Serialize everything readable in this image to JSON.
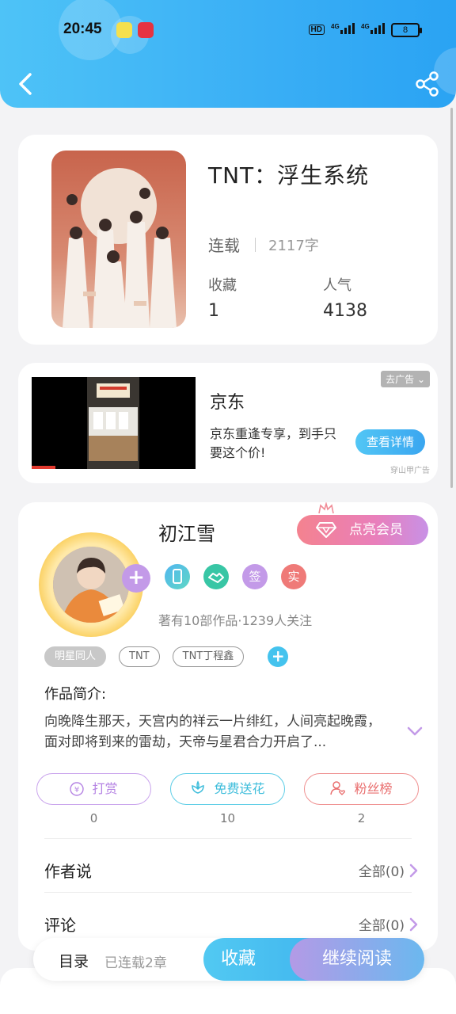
{
  "status_bar": {
    "time": "20:45",
    "network_badge": "HD",
    "signal1": "⁴ᴳ",
    "signal2": "4G",
    "battery": "8"
  },
  "book": {
    "title": "TNT：浮生系统",
    "status": "连载",
    "word_count": "2117字",
    "favorites_label": "收藏",
    "favorites_value": "1",
    "popularity_label": "人气",
    "popularity_value": "4138"
  },
  "ad": {
    "remove_label": "去广告",
    "title": "京东",
    "description": "京东重逢专享，到手只要这个价!",
    "cta": "查看详情",
    "source": "穿山甲广告"
  },
  "author": {
    "name": "初江雪",
    "vip_label": "点亮会员",
    "badges": [
      "",
      "",
      "签",
      "实"
    ],
    "stats": "著有10部作品·1239人关注",
    "tags": [
      "明星同人",
      "TNT",
      "TNT丁程鑫"
    ],
    "intro_label": "作品简介:",
    "intro_text": "向晚降生那天，天宫内的祥云一片绯红，人间亮起晚霞，面对即将到来的雷劫，天帝与星君合力开启了..."
  },
  "actions": [
    {
      "label": "打赏",
      "count": "0"
    },
    {
      "label": "免费送花",
      "count": "10"
    },
    {
      "label": "粉丝榜",
      "count": "2"
    }
  ],
  "rows": {
    "author_says": "作者说",
    "author_says_count": "全部(0)",
    "comments": "评论",
    "comments_count": "全部(0)"
  },
  "bottom_bar": {
    "toc": "目录",
    "toc_status": "已连载2章",
    "favorite": "收藏",
    "continue": "继续阅读"
  },
  "colors": {
    "header": "#39aef5",
    "accent_purple": "#c39ae8",
    "accent_blue": "#44c3ee",
    "reward": "#c39ae8",
    "flower": "#4ec9e6",
    "fans": "#ef8a8a"
  }
}
